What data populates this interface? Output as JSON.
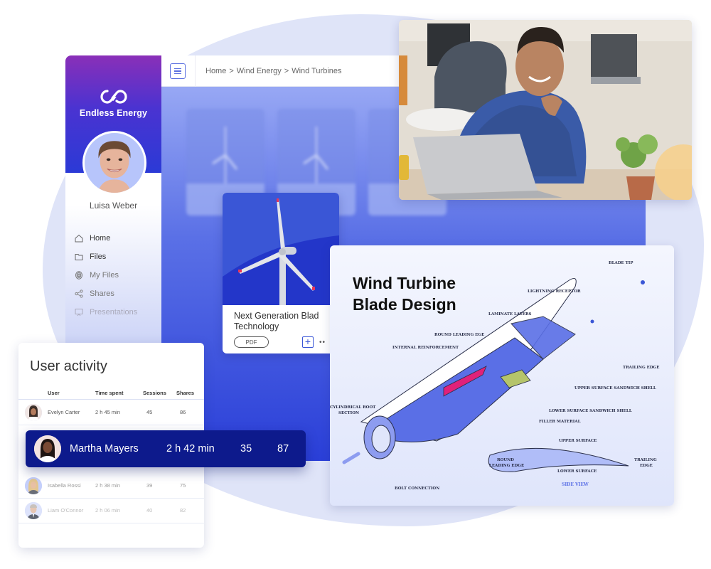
{
  "sidebar": {
    "brand": "Endless Energy",
    "user_name": "Luisa Weber",
    "items": [
      {
        "label": "Home",
        "icon": "home-icon"
      },
      {
        "label": "Files",
        "icon": "folder-icon"
      },
      {
        "label": "My Files",
        "icon": "fingerprint-icon"
      },
      {
        "label": "Shares",
        "icon": "share-icon"
      },
      {
        "label": "Presentations",
        "icon": "presentation-icon"
      }
    ]
  },
  "header": {
    "menu_icon": "hamburger-menu-icon",
    "breadcrumb": [
      "Home",
      "Wind Energy",
      "Wind Turbines"
    ],
    "separator": ">"
  },
  "file_card": {
    "title": "Next Generation Blad Technology",
    "badge": "PDF",
    "add_label": "+",
    "more_label": "••"
  },
  "diagram": {
    "title_line1": "Wind Turbine",
    "title_line2": "Blade Design",
    "labels": {
      "blade_tip": "BLADE TIP",
      "lightning_receptor": "LIGHTNING RECEPTOR",
      "laminate_layers": "LAMINATE LAYERS",
      "round_leading_ege": "ROUND LEADING EGE",
      "internal_reinforcement": "INTERNAL REINFORCEMENT",
      "trailing_edge": "TRAILING EDGE",
      "upper_surface_sandwich_shell": "UPPER SURFACE SANDWICH SHELL",
      "lower_surface_sandwich_shell": "LOWER SURFACE SANDWICH SHELL",
      "filler_material": "FILLER MATERIAL",
      "cylindrical_root_1": "CYLINDRICAL ROOT",
      "cylindrical_root_2": "SECTION",
      "bolt_connection": "BOLT CONNECTION",
      "upper_surface": "UPPER SURFACE",
      "lower_surface": "LOWER SURFACE",
      "round_leading_edge_1": "ROUND",
      "round_leading_edge_2": "LEADING EDGE",
      "trailing_edge_side_1": "TRAILING",
      "trailing_edge_side_2": "EDGE",
      "side_view": "SIDE VIEW"
    }
  },
  "activity": {
    "title": "User activity",
    "columns": [
      "User",
      "Time spent",
      "Sessions",
      "Shares"
    ],
    "rows": [
      {
        "name": "Evelyn Carter",
        "time": "2 h  45 min",
        "sessions": "45",
        "shares": "86"
      },
      {
        "name": "Isabella Rossi",
        "time": "2 h  38 min",
        "sessions": "39",
        "shares": "75"
      },
      {
        "name": "Liam O'Connor",
        "time": "2 h  06 min",
        "sessions": "40",
        "shares": "82"
      }
    ],
    "highlight": {
      "name": "Martha Mayers",
      "time": "2 h 42 min",
      "sessions": "35",
      "shares": "87"
    }
  },
  "colors": {
    "brand_gradient_top": "#8a2fb8",
    "brand_gradient_bottom": "#2b3ad6",
    "accent": "#3a56d6",
    "highlight_row": "#0d1a8c",
    "reinforcement": "#e0217a",
    "filler": "#b5c46a"
  }
}
